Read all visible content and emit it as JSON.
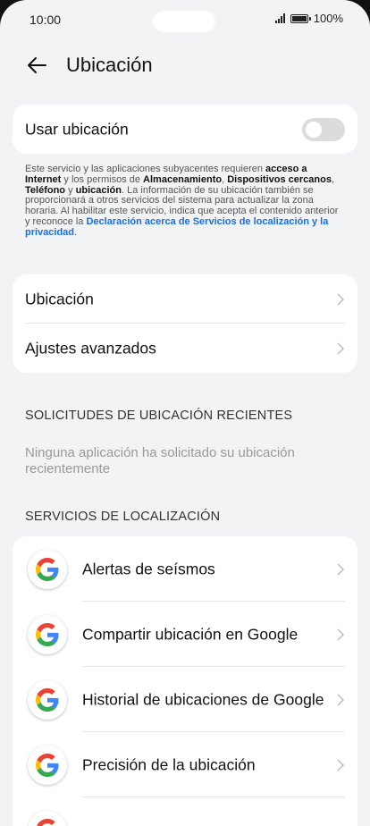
{
  "status_bar": {
    "time": "10:00",
    "battery": "100%"
  },
  "header": {
    "title": "Ubicación"
  },
  "location_toggle": {
    "label": "Usar ubicación",
    "enabled": false
  },
  "description": {
    "p1": "Este servicio y las aplicaciones subyacentes requieren ",
    "b1": "acceso a Internet",
    "p2": " y los permisos de ",
    "b2": "Almacenamiento",
    "p3": ", ",
    "b3": "Dispositivos cercanos",
    "p4": ", ",
    "b4": "Teléfono",
    "p5": " y ",
    "b5": "ubicación",
    "p6": ". La información de su ubicación también se proporcionará a otros servicios del sistema para actualizar la zona horaria. Al habilitar este servicio, indica que acepta el contenido anterior y reconoce la ",
    "link": "Declaración acerca de Servicios de localización y la privacidad",
    "p7": "."
  },
  "settings_menu": {
    "items": [
      {
        "label": "Ubicación"
      },
      {
        "label": "Ajustes avanzados"
      }
    ]
  },
  "recent_requests": {
    "header": "SOLICITUDES DE UBICACIÓN RECIENTES",
    "empty_text": "Ninguna aplicación ha solicitado su ubicación recientemente"
  },
  "location_services": {
    "header": "SERVICIOS DE LOCALIZACIÓN",
    "items": [
      {
        "label": "Alertas de seísmos",
        "icon": "google-icon"
      },
      {
        "label": "Compartir ubicación en Google",
        "icon": "google-icon"
      },
      {
        "label": "Historial de ubicaciones de Google",
        "icon": "google-icon"
      },
      {
        "label": "Precisión de la ubicación",
        "icon": "google-icon"
      }
    ]
  },
  "colors": {
    "background": "#f1f3f5",
    "link": "#1a6fe0",
    "card": "#ffffff"
  }
}
